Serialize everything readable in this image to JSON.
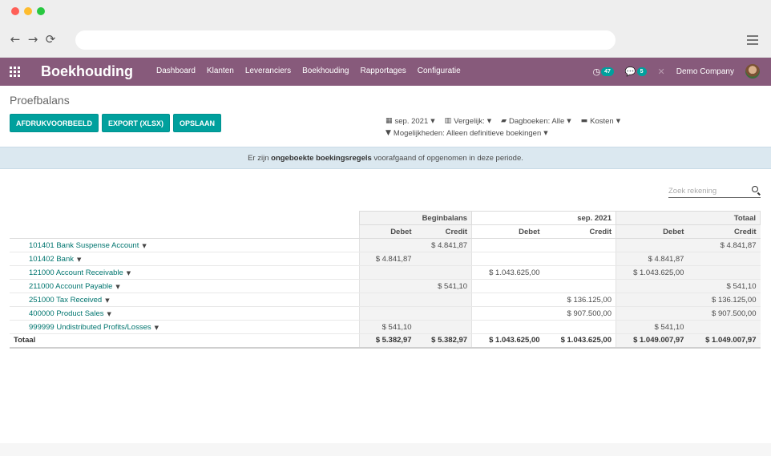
{
  "browser": {
    "back_glyph": "←",
    "forward_glyph": "→",
    "reload_glyph": "⟳",
    "url": ""
  },
  "navbar": {
    "brand": "Boekhouding",
    "menu": [
      "Dashboard",
      "Klanten",
      "Leveranciers",
      "Boekhouding",
      "Rapportages",
      "Configuratie"
    ],
    "activity_count": "47",
    "messages_count": "5",
    "company": "Demo Company",
    "accent_color": "#875a7b"
  },
  "page": {
    "title": "Proefbalans",
    "buttons": {
      "print_preview": "AFDRUKVOORBEELD",
      "export": "EXPORT (XLSX)",
      "save": "OPSLAAN"
    },
    "filters": {
      "date": "sep. 2021",
      "compare": "Vergelijk:",
      "journals": "Dagboeken: Alle",
      "analytic": "Kosten",
      "options": "Mogelijkheden: Alleen definitieve boekingen"
    },
    "info": {
      "before": "Er zijn ",
      "bold": "ongeboekte boekingsregels",
      "after": " voorafgaand of opgenomen in deze periode."
    },
    "search_placeholder": "Zoek rekening"
  },
  "table": {
    "groups": [
      "Beginbalans",
      "sep. 2021",
      "Totaal"
    ],
    "subheaders": [
      "Debet",
      "Credit",
      "Debet",
      "Credit",
      "Debet",
      "Credit"
    ],
    "rows": [
      {
        "account": "101401 Bank Suspense Account",
        "values": [
          "",
          "$ 4.841,87",
          "",
          "",
          "",
          "$ 4.841,87"
        ]
      },
      {
        "account": "101402 Bank",
        "values": [
          "$ 4.841,87",
          "",
          "",
          "",
          "$ 4.841,87",
          ""
        ]
      },
      {
        "account": "121000 Account Receivable",
        "values": [
          "",
          "",
          "$ 1.043.625,00",
          "",
          "$ 1.043.625,00",
          ""
        ]
      },
      {
        "account": "211000 Account Payable",
        "values": [
          "",
          "$ 541,10",
          "",
          "",
          "",
          "$ 541,10"
        ]
      },
      {
        "account": "251000 Tax Received",
        "values": [
          "",
          "",
          "",
          "$ 136.125,00",
          "",
          "$ 136.125,00"
        ]
      },
      {
        "account": "400000 Product Sales",
        "values": [
          "",
          "",
          "",
          "$ 907.500,00",
          "",
          "$ 907.500,00"
        ]
      },
      {
        "account": "999999 Undistributed Profits/Losses",
        "values": [
          "$ 541,10",
          "",
          "",
          "",
          "$ 541,10",
          ""
        ]
      }
    ],
    "total": {
      "label": "Totaal",
      "values": [
        "$ 5.382,97",
        "$ 5.382,97",
        "$ 1.043.625,00",
        "$ 1.043.625,00",
        "$ 1.049.007,97",
        "$ 1.049.007,97"
      ]
    }
  }
}
